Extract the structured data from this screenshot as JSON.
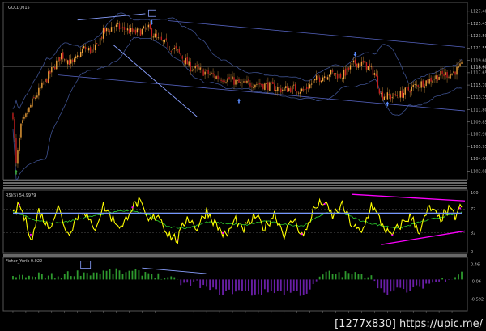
{
  "chart_data": [
    {
      "type": "line",
      "panel": "price",
      "title": "GOLD,M15",
      "y_tick_labels": [
        "1127.40",
        "1125.45",
        "1123.50",
        "1121.55",
        "1119.60",
        "1117.65",
        "1115.70",
        "1113.75",
        "1111.80",
        "1109.85",
        "1107.90",
        "1105.95",
        "1104.00",
        "1102.05"
      ],
      "current_price": "1118.60",
      "ylim": [
        1101.1,
        1128.4
      ],
      "candles": {
        "start_index": 8,
        "end_index": 286,
        "anchors": [
          [
            8,
            1111.0
          ],
          [
            10,
            1103.0
          ],
          [
            13,
            1109.0
          ],
          [
            20,
            1113.0
          ],
          [
            26,
            1115.5
          ],
          [
            32,
            1118.0
          ],
          [
            38,
            1120.5
          ],
          [
            45,
            1119.0
          ],
          [
            52,
            1121.5
          ],
          [
            58,
            1121.0
          ],
          [
            64,
            1124.0
          ],
          [
            70,
            1125.0
          ],
          [
            76,
            1124.6
          ],
          [
            84,
            1124.0
          ],
          [
            92,
            1124.6
          ],
          [
            98,
            1122.8
          ],
          [
            104,
            1122.0
          ],
          [
            110,
            1121.0
          ],
          [
            118,
            1118.5
          ],
          [
            126,
            1117.8
          ],
          [
            134,
            1117.0
          ],
          [
            142,
            1116.6
          ],
          [
            150,
            1115.8
          ],
          [
            158,
            1116.0
          ],
          [
            166,
            1115.6
          ],
          [
            174,
            1115.0
          ],
          [
            182,
            1115.2
          ],
          [
            188,
            1114.8
          ],
          [
            196,
            1116.6
          ],
          [
            204,
            1117.6
          ],
          [
            212,
            1117.2
          ],
          [
            220,
            1119.2
          ],
          [
            226,
            1119.0
          ],
          [
            232,
            1117.6
          ],
          [
            236,
            1114.2
          ],
          [
            242,
            1113.8
          ],
          [
            248,
            1114.2
          ],
          [
            256,
            1115.4
          ],
          [
            264,
            1116.3
          ],
          [
            272,
            1117.2
          ],
          [
            280,
            1117.6
          ],
          [
            286,
            1118.6
          ]
        ]
      },
      "arrows_up": [
        1102.3,
        1113.6,
        1113.1
      ],
      "arrows_down": [
        1125.2,
        1120.2
      ]
    },
    {
      "type": "line",
      "panel": "rsi",
      "title": "RSI(5) 54.9979",
      "series_colors": [
        "#ffff00",
        "#2dcc2d",
        "#ff00ff"
      ],
      "y_tick_labels": [
        "100",
        "72",
        "32",
        "0"
      ],
      "ylim": [
        0,
        100
      ],
      "series": [
        {
          "values_anchor": [
            [
              8,
              60
            ],
            [
              12,
              80
            ],
            [
              16,
              50
            ],
            [
              20,
              22
            ],
            [
              24,
              70
            ],
            [
              30,
              40
            ],
            [
              36,
              75
            ],
            [
              42,
              30
            ],
            [
              48,
              60
            ],
            [
              52,
              72
            ],
            [
              58,
              35
            ],
            [
              64,
              78
            ],
            [
              70,
              55
            ],
            [
              76,
              40
            ],
            [
              80,
              70
            ],
            [
              86,
              85
            ],
            [
              92,
              50
            ],
            [
              98,
              65
            ],
            [
              104,
              30
            ],
            [
              110,
              20
            ],
            [
              116,
              60
            ],
            [
              122,
              40
            ],
            [
              128,
              70
            ],
            [
              134,
              45
            ],
            [
              140,
              25
            ],
            [
              146,
              55
            ],
            [
              150,
              35
            ],
            [
              158,
              60
            ],
            [
              164,
              40
            ],
            [
              170,
              65
            ],
            [
              176,
              30
            ],
            [
              182,
              55
            ],
            [
              188,
              25
            ],
            [
              194,
              70
            ],
            [
              200,
              85
            ],
            [
              206,
              60
            ],
            [
              212,
              78
            ],
            [
              218,
              45
            ],
            [
              224,
              30
            ],
            [
              230,
              80
            ],
            [
              236,
              50
            ],
            [
              242,
              25
            ],
            [
              248,
              45
            ],
            [
              254,
              60
            ],
            [
              260,
              35
            ],
            [
              266,
              75
            ],
            [
              272,
              55
            ],
            [
              278,
              70
            ],
            [
              282,
              60
            ],
            [
              286,
              78
            ]
          ]
        },
        {
          "values_anchor": [
            [
              8,
              68
            ],
            [
              20,
              55
            ],
            [
              32,
              48
            ],
            [
              44,
              52
            ],
            [
              56,
              60
            ],
            [
              68,
              66
            ],
            [
              80,
              70
            ],
            [
              92,
              62
            ],
            [
              104,
              42
            ],
            [
              116,
              40
            ],
            [
              128,
              50
            ],
            [
              140,
              48
            ],
            [
              152,
              45
            ],
            [
              164,
              52
            ],
            [
              176,
              46
            ],
            [
              188,
              44
            ],
            [
              200,
              64
            ],
            [
              212,
              66
            ],
            [
              224,
              52
            ],
            [
              236,
              44
            ],
            [
              248,
              40
            ],
            [
              260,
              50
            ],
            [
              272,
              58
            ],
            [
              286,
              66
            ]
          ]
        }
      ]
    },
    {
      "type": "line",
      "panel": "fisher",
      "title": "Fisher_Yurik 0.022",
      "series_colors": [
        "#7aa2ff",
        "#4a6cff",
        "#c0a060"
      ],
      "y_tick_labels": [
        "0.46",
        "-0.06",
        "-0.592"
      ],
      "ylim": [
        -0.9,
        0.6
      ],
      "fisher_anchors": [
        [
          8,
          0.05
        ],
        [
          14,
          0.25
        ],
        [
          20,
          0.1
        ],
        [
          26,
          0.3
        ],
        [
          34,
          0.15
        ],
        [
          42,
          0.32
        ],
        [
          50,
          0.38
        ],
        [
          58,
          0.36
        ],
        [
          64,
          0.42
        ],
        [
          70,
          0.45
        ],
        [
          76,
          0.4
        ],
        [
          84,
          0.38
        ],
        [
          92,
          0.38
        ],
        [
          98,
          0.2
        ],
        [
          104,
          0.05
        ],
        [
          110,
          -0.1
        ],
        [
          116,
          -0.3
        ],
        [
          122,
          -0.2
        ],
        [
          128,
          -0.5
        ],
        [
          134,
          -0.65
        ],
        [
          140,
          -0.75
        ],
        [
          146,
          -0.6
        ],
        [
          152,
          -0.7
        ],
        [
          158,
          -0.8
        ],
        [
          164,
          -0.7
        ],
        [
          170,
          -0.6
        ],
        [
          176,
          -0.7
        ],
        [
          182,
          -0.65
        ],
        [
          188,
          -0.8
        ],
        [
          194,
          -0.4
        ],
        [
          200,
          0.3
        ],
        [
          206,
          0.36
        ],
        [
          212,
          0.28
        ],
        [
          218,
          0.34
        ],
        [
          224,
          0.2
        ],
        [
          230,
          0.3
        ],
        [
          236,
          -0.6
        ],
        [
          242,
          -0.7
        ],
        [
          248,
          -0.55
        ],
        [
          254,
          -0.65
        ],
        [
          260,
          -0.4
        ],
        [
          266,
          -0.2
        ],
        [
          272,
          -0.1
        ],
        [
          278,
          0.1
        ],
        [
          282,
          0.2
        ],
        [
          286,
          0.45
        ]
      ]
    }
  ],
  "colors": {
    "bull": "#f2a33a",
    "bear": "#c41f1f",
    "wick": "#9a6a2a",
    "bands": "#3c4f8c",
    "trend": "#5563c0",
    "axis_text": "#bbbbbb",
    "rsi": "#ffff00",
    "rsi_ma": "#2dcc2d",
    "rsi_dots": "#ff00ff",
    "fisher_hist_pos": "#2e9a2e",
    "fisher_hist_neg": "#6a1fa8"
  },
  "watermark": "[1277x830] https://upic.me/"
}
